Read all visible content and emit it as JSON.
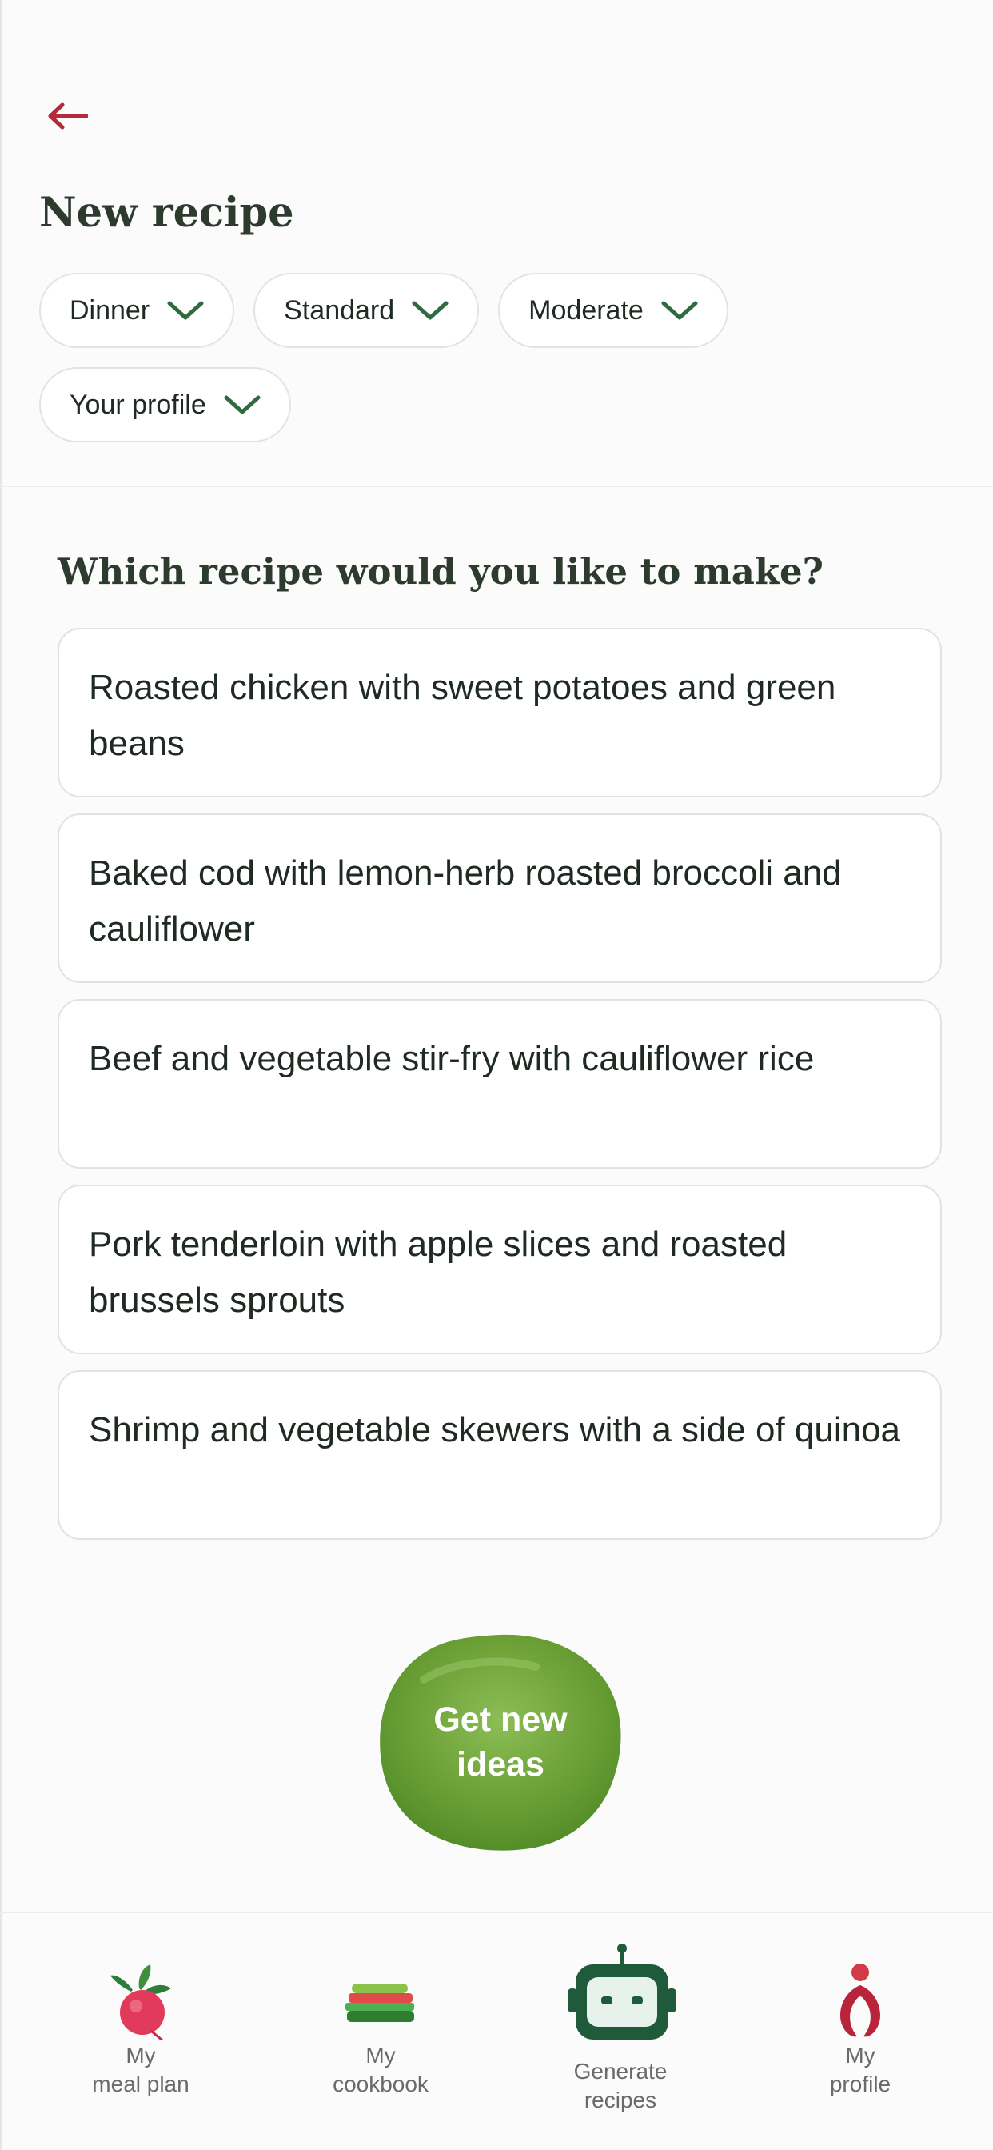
{
  "header": {
    "title": "New recipe",
    "back_icon": "arrow-left-icon"
  },
  "filters": [
    {
      "label": "Dinner",
      "icon": "chevron-down-icon"
    },
    {
      "label": "Standard",
      "icon": "chevron-down-icon"
    },
    {
      "label": "Moderate",
      "icon": "chevron-down-icon"
    },
    {
      "label": "Your profile",
      "icon": "chevron-down-icon"
    }
  ],
  "main": {
    "question": "Which recipe would you like to make?",
    "recipes": [
      "Roasted chicken with sweet potatoes and green beans",
      "Baked cod with lemon-herb roasted broccoli and cauliflower",
      "Beef and vegetable stir-fry with cauliflower rice",
      "Pork tenderloin with apple slices and roasted brussels sprouts",
      "Shrimp and vegetable skewers with a side of quinoa"
    ],
    "cta_line1": "Get new",
    "cta_line2": "ideas"
  },
  "nav": {
    "items": [
      {
        "line1": "My",
        "line2": "meal plan",
        "icon": "radish-icon"
      },
      {
        "line1": "My",
        "line2": "cookbook",
        "icon": "sandwich-stack-icon"
      },
      {
        "line1": "Generate",
        "line2": "recipes",
        "icon": "robot-icon"
      },
      {
        "line1": "My",
        "line2": "profile",
        "icon": "person-icon"
      }
    ]
  },
  "colors": {
    "accent_green": "#2f6b3e",
    "cta_green": "#6fa43a",
    "back_red": "#b42a3a",
    "text": "#1f2a22"
  }
}
